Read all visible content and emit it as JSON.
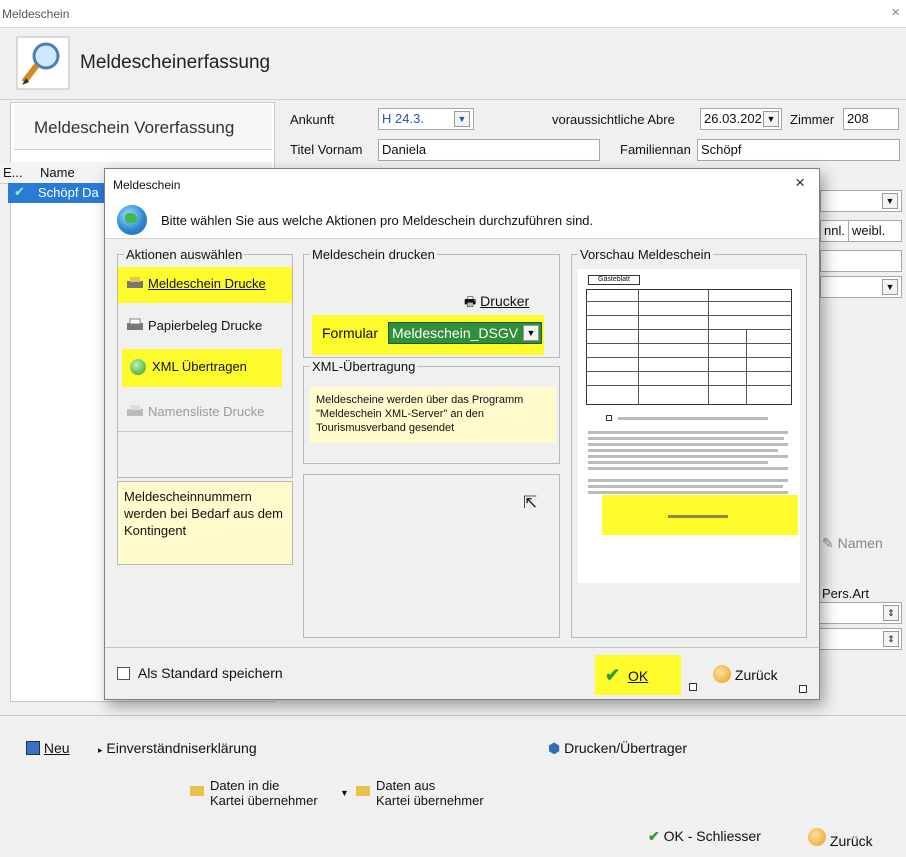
{
  "window": {
    "title": "Meldeschein",
    "close": "×"
  },
  "header": {
    "title": "Meldescheinerfassung"
  },
  "left": {
    "vorerfassung": "Meldeschein Vorerfassung",
    "col_e": "E...",
    "col_name": "Name",
    "selected_name": "Schöpf Da"
  },
  "form": {
    "ankunft_label": "Ankunft",
    "ankunft_value": "H 24.3.",
    "abreise_label": "voraussichtliche Abre",
    "abreise_value": "26.03.202",
    "zimmer_label": "Zimmer",
    "zimmer_value": "208",
    "titel_label": "Titel Vornam",
    "vorname_value": "Daniela",
    "familienname_label": "Familiennan",
    "familienname_value": "Schöpf",
    "geschl_m": "nnl.",
    "geschl_w": "weibl.",
    "namen_btn": "Namen",
    "pers_art": "Pers.Art"
  },
  "dialog": {
    "title": "Meldeschein",
    "close": "×",
    "info": "Bitte wählen Sie aus welche Aktionen pro Meldeschein durchzuführen sind.",
    "actions_title": "Aktionen auswählen",
    "actions": [
      {
        "label": "Meldeschein Drucke"
      },
      {
        "label": "Papierbeleg Drucke"
      },
      {
        "label": "XML Übertragen"
      },
      {
        "label": "Namensliste Drucke"
      }
    ],
    "note_left": "Meldescheinnummern werden bei Bedarf aus dem Kontingent",
    "print_title": "Meldeschein drucken",
    "printer_btn": "Drucker",
    "formular_label": "Formular",
    "formular_value": "Meldeschein_DSGV",
    "xml_title": "XML-Übertragung",
    "xml_note": "Meldescheine werden über das Programm \"Meldeschein XML-Server\" an den Tourismusverband gesendet",
    "preview_title": "Vorschau Meldeschein",
    "preview_header": "Gästeblatt",
    "standard_label": "Als Standard speichern",
    "ok": "OK",
    "back": "Zurück"
  },
  "bottom": {
    "neu": "Neu",
    "einverstaendnis": "Einverständniserklärung",
    "drucken": "Drucken/Übertrager",
    "daten_in_1": "Daten in die",
    "daten_in_2": "Kartei übernehmer",
    "daten_aus_1": "Daten aus",
    "daten_aus_2": "Kartei übernehmer",
    "ok_schliessen": "OK - Schliesser",
    "zurueck": "Zurück"
  }
}
